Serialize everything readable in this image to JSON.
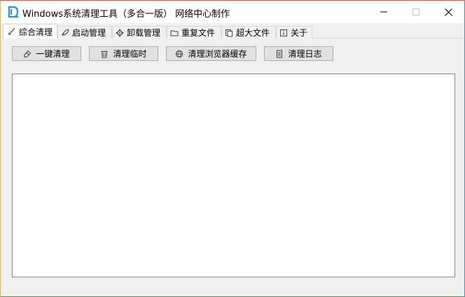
{
  "window": {
    "title": "Windows系统清理工具（多合一版） 网络中心制作"
  },
  "tabs": [
    {
      "label": "综合清理",
      "icon": "broom-icon",
      "active": true
    },
    {
      "label": "启动管理",
      "icon": "rocket-icon",
      "active": false
    },
    {
      "label": "卸载管理",
      "icon": "gear-icon",
      "active": false
    },
    {
      "label": "重复文件",
      "icon": "folder-icon",
      "active": false
    },
    {
      "label": "超大文件",
      "icon": "copy-files-icon",
      "active": false
    },
    {
      "label": "关于",
      "icon": "info-icon",
      "active": false
    }
  ],
  "toolbar": {
    "one_click": "一键清理",
    "clean_temp": "清理临时",
    "clean_browser": "清理浏览器缓存",
    "clean_log": "清理日志"
  },
  "log": {
    "text": ""
  },
  "colors": {
    "accent": "#2f8fd8",
    "button_bg": "#e1e1e1",
    "button_border": "#adadad",
    "window_bg": "#f0f0f0"
  }
}
